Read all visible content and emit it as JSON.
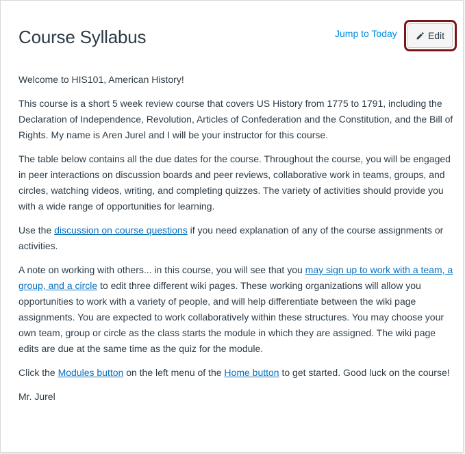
{
  "header": {
    "title": "Course Syllabus",
    "jump_link": "Jump to Today",
    "edit_label": "Edit"
  },
  "body": {
    "welcome": "Welcome to HIS101, American History!",
    "intro": "This course is a short 5 week review course that covers US History from 1775 to 1791, including the Declaration of Independence, Revolution, Articles of Confederation and the Constitution, and the Bill of Rights. My name is Aren Jurel and I will be your instructor for this course.",
    "table_note": "The table below contains all the due dates for the course. Throughout the course, you will be engaged in peer interactions on discussion boards and peer reviews, collaborative work in teams, groups, and circles, watching videos, writing, and completing quizzes. The variety of activities should provide you with a wide range of opportunities for learning.",
    "discussion": {
      "before": "Use the ",
      "link": "discussion on course questions",
      "after": " if you need explanation of any of the course assignments or activities."
    },
    "working": {
      "before": "A note on working with others... in this course, you will see that you ",
      "link": "may sign up to work with a team, a group, and a circle",
      "after": " to edit three different wiki pages. These working organizations will allow you opportunities to work with a variety of people, and will help differentiate between the wiki page assignments. You are expected to work collaboratively within these structures. You may choose your own team, group or circle as the class starts the module in which they are assigned. The wiki page edits are due at the same time as the quiz for the module."
    },
    "start": {
      "before": "Click the ",
      "modules_link": "Modules button",
      "middle": " on the left menu of the ",
      "home_link": "Home button",
      "after": " to get started. Good luck on the course!"
    },
    "signature": "Mr. Jurel"
  },
  "colors": {
    "link": "#0770bf",
    "jump_link": "#008ee2",
    "highlight_border": "#7a1418",
    "text": "#2d3b45"
  },
  "icons": {
    "edit": "pencil-icon"
  }
}
